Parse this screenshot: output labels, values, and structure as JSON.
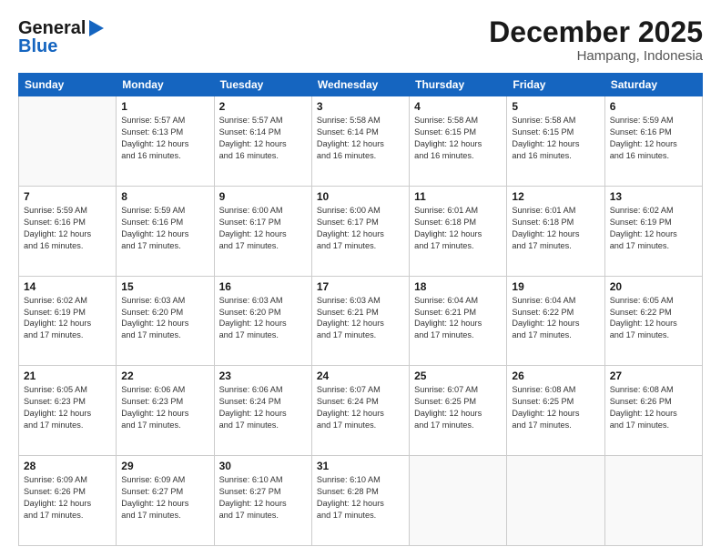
{
  "header": {
    "logo_line1": "General",
    "logo_line2": "Blue",
    "month": "December 2025",
    "location": "Hampang, Indonesia"
  },
  "weekdays": [
    "Sunday",
    "Monday",
    "Tuesday",
    "Wednesday",
    "Thursday",
    "Friday",
    "Saturday"
  ],
  "weeks": [
    [
      {
        "day": "",
        "info": ""
      },
      {
        "day": "1",
        "info": "Sunrise: 5:57 AM\nSunset: 6:13 PM\nDaylight: 12 hours\nand 16 minutes."
      },
      {
        "day": "2",
        "info": "Sunrise: 5:57 AM\nSunset: 6:14 PM\nDaylight: 12 hours\nand 16 minutes."
      },
      {
        "day": "3",
        "info": "Sunrise: 5:58 AM\nSunset: 6:14 PM\nDaylight: 12 hours\nand 16 minutes."
      },
      {
        "day": "4",
        "info": "Sunrise: 5:58 AM\nSunset: 6:15 PM\nDaylight: 12 hours\nand 16 minutes."
      },
      {
        "day": "5",
        "info": "Sunrise: 5:58 AM\nSunset: 6:15 PM\nDaylight: 12 hours\nand 16 minutes."
      },
      {
        "day": "6",
        "info": "Sunrise: 5:59 AM\nSunset: 6:16 PM\nDaylight: 12 hours\nand 16 minutes."
      }
    ],
    [
      {
        "day": "7",
        "info": "Sunrise: 5:59 AM\nSunset: 6:16 PM\nDaylight: 12 hours\nand 16 minutes."
      },
      {
        "day": "8",
        "info": "Sunrise: 5:59 AM\nSunset: 6:16 PM\nDaylight: 12 hours\nand 17 minutes."
      },
      {
        "day": "9",
        "info": "Sunrise: 6:00 AM\nSunset: 6:17 PM\nDaylight: 12 hours\nand 17 minutes."
      },
      {
        "day": "10",
        "info": "Sunrise: 6:00 AM\nSunset: 6:17 PM\nDaylight: 12 hours\nand 17 minutes."
      },
      {
        "day": "11",
        "info": "Sunrise: 6:01 AM\nSunset: 6:18 PM\nDaylight: 12 hours\nand 17 minutes."
      },
      {
        "day": "12",
        "info": "Sunrise: 6:01 AM\nSunset: 6:18 PM\nDaylight: 12 hours\nand 17 minutes."
      },
      {
        "day": "13",
        "info": "Sunrise: 6:02 AM\nSunset: 6:19 PM\nDaylight: 12 hours\nand 17 minutes."
      }
    ],
    [
      {
        "day": "14",
        "info": "Sunrise: 6:02 AM\nSunset: 6:19 PM\nDaylight: 12 hours\nand 17 minutes."
      },
      {
        "day": "15",
        "info": "Sunrise: 6:03 AM\nSunset: 6:20 PM\nDaylight: 12 hours\nand 17 minutes."
      },
      {
        "day": "16",
        "info": "Sunrise: 6:03 AM\nSunset: 6:20 PM\nDaylight: 12 hours\nand 17 minutes."
      },
      {
        "day": "17",
        "info": "Sunrise: 6:03 AM\nSunset: 6:21 PM\nDaylight: 12 hours\nand 17 minutes."
      },
      {
        "day": "18",
        "info": "Sunrise: 6:04 AM\nSunset: 6:21 PM\nDaylight: 12 hours\nand 17 minutes."
      },
      {
        "day": "19",
        "info": "Sunrise: 6:04 AM\nSunset: 6:22 PM\nDaylight: 12 hours\nand 17 minutes."
      },
      {
        "day": "20",
        "info": "Sunrise: 6:05 AM\nSunset: 6:22 PM\nDaylight: 12 hours\nand 17 minutes."
      }
    ],
    [
      {
        "day": "21",
        "info": "Sunrise: 6:05 AM\nSunset: 6:23 PM\nDaylight: 12 hours\nand 17 minutes."
      },
      {
        "day": "22",
        "info": "Sunrise: 6:06 AM\nSunset: 6:23 PM\nDaylight: 12 hours\nand 17 minutes."
      },
      {
        "day": "23",
        "info": "Sunrise: 6:06 AM\nSunset: 6:24 PM\nDaylight: 12 hours\nand 17 minutes."
      },
      {
        "day": "24",
        "info": "Sunrise: 6:07 AM\nSunset: 6:24 PM\nDaylight: 12 hours\nand 17 minutes."
      },
      {
        "day": "25",
        "info": "Sunrise: 6:07 AM\nSunset: 6:25 PM\nDaylight: 12 hours\nand 17 minutes."
      },
      {
        "day": "26",
        "info": "Sunrise: 6:08 AM\nSunset: 6:25 PM\nDaylight: 12 hours\nand 17 minutes."
      },
      {
        "day": "27",
        "info": "Sunrise: 6:08 AM\nSunset: 6:26 PM\nDaylight: 12 hours\nand 17 minutes."
      }
    ],
    [
      {
        "day": "28",
        "info": "Sunrise: 6:09 AM\nSunset: 6:26 PM\nDaylight: 12 hours\nand 17 minutes."
      },
      {
        "day": "29",
        "info": "Sunrise: 6:09 AM\nSunset: 6:27 PM\nDaylight: 12 hours\nand 17 minutes."
      },
      {
        "day": "30",
        "info": "Sunrise: 6:10 AM\nSunset: 6:27 PM\nDaylight: 12 hours\nand 17 minutes."
      },
      {
        "day": "31",
        "info": "Sunrise: 6:10 AM\nSunset: 6:28 PM\nDaylight: 12 hours\nand 17 minutes."
      },
      {
        "day": "",
        "info": ""
      },
      {
        "day": "",
        "info": ""
      },
      {
        "day": "",
        "info": ""
      }
    ]
  ]
}
